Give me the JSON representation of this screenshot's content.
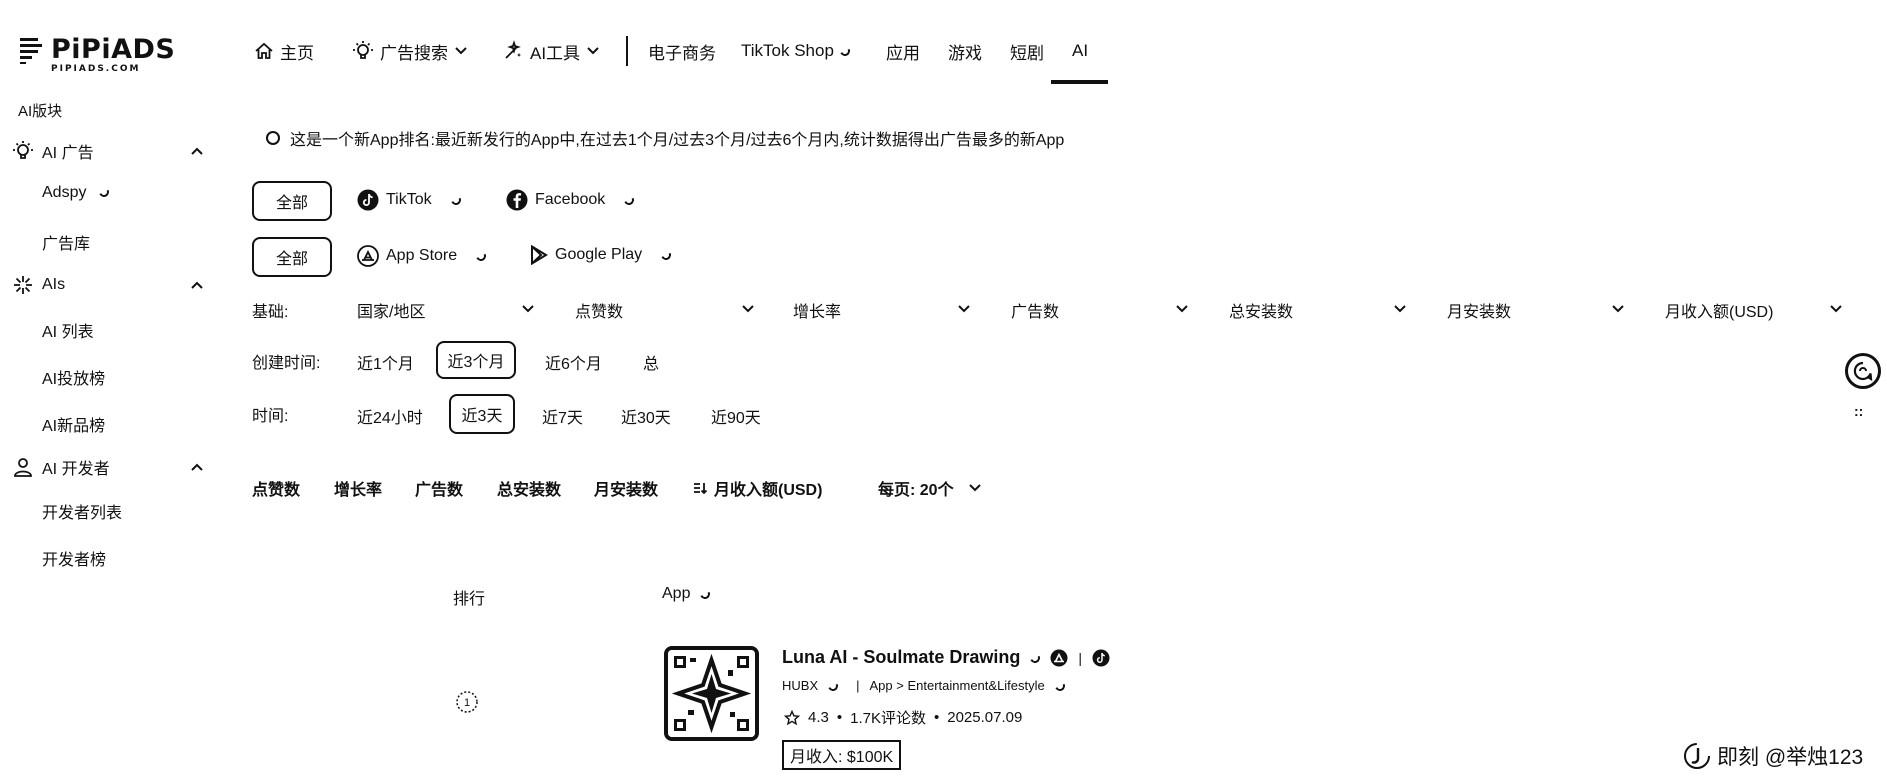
{
  "brand": {
    "name": "PiPiADS",
    "sub": "PIPIADS.COM"
  },
  "nav": {
    "home": "主页",
    "ad_search": "广告搜索",
    "ai_tools": "AI工具",
    "ecommerce": "电子商务",
    "tiktok_shop": "TikTok Shop",
    "apps": "应用",
    "games": "游戏",
    "short_drama": "短剧",
    "ai": "AI"
  },
  "sidebar": {
    "section_title": "AI版块",
    "groups": [
      {
        "label": "AI 广告",
        "icon": "bulb-icon",
        "items": [
          "Adspy",
          "广告库"
        ]
      },
      {
        "label": "AIs",
        "icon": "sparkle-icon",
        "items": [
          "AI 列表",
          "AI投放榜",
          "AI新品榜"
        ]
      },
      {
        "label": "AI 开发者",
        "icon": "person-icon",
        "items": [
          "开发者列表",
          "开发者榜"
        ]
      }
    ]
  },
  "description": "这是一个新App排名:最近新发行的App中,在过去1个月/过去3个月/过去6个月内,统计数据得出广告最多的新App",
  "platform_filter": {
    "all": "全部",
    "tiktok": "TikTok",
    "facebook": "Facebook"
  },
  "store_filter": {
    "all": "全部",
    "app_store": "App Store",
    "google_play": "Google Play"
  },
  "basic_filters": {
    "label": "基础:",
    "items": [
      "国家/地区",
      "点赞数",
      "增长率",
      "广告数",
      "总安装数",
      "月安装数",
      "月收入额(USD)"
    ]
  },
  "created_time": {
    "label": "创建时间:",
    "options": [
      "近1个月",
      "近3个月",
      "近6个月",
      "总"
    ],
    "selected": "近3个月"
  },
  "time": {
    "label": "时间:",
    "options": [
      "近24小时",
      "近3天",
      "近7天",
      "近30天",
      "近90天"
    ],
    "selected": "近3天"
  },
  "sort_bar": {
    "items": [
      "点赞数",
      "增长率",
      "广告数",
      "总安装数",
      "月安装数",
      "月收入额(USD)"
    ],
    "per_page": "每页: 20个"
  },
  "table": {
    "col_rank": "排行",
    "col_app": "App"
  },
  "app": {
    "name": "Luna AI - Soulmate Drawing",
    "developer": "HUBX",
    "category": "App > Entertainment&Lifestyle",
    "rating": "4.3",
    "reviews": "1.7K评论数",
    "date": "2025.07.09",
    "income": "月收入: $100K"
  },
  "watermark": "即刻 @举烛123"
}
